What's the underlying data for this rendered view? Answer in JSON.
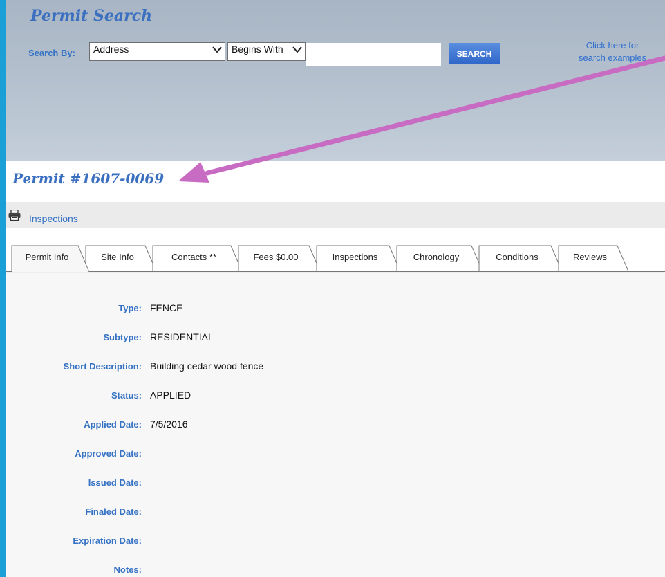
{
  "search": {
    "title": "Permit Search",
    "search_by_label": "Search By:",
    "field_selected": "Address",
    "match_selected": "Begins With",
    "input_value": "",
    "button_label": "SEARCH",
    "examples_link_line1": "Click here for",
    "examples_link_line2": "search examples"
  },
  "permit": {
    "number": "Permit #1607-0069"
  },
  "toolbar": {
    "inspections_label": "Inspections"
  },
  "tabs": [
    {
      "label": "Permit Info",
      "active": true
    },
    {
      "label": "Site Info"
    },
    {
      "label": "Contacts **"
    },
    {
      "label": "Fees $0.00"
    },
    {
      "label": "Inspections"
    },
    {
      "label": "Chronology"
    },
    {
      "label": "Conditions"
    },
    {
      "label": "Reviews"
    }
  ],
  "details": [
    {
      "label": "Type:",
      "value": "FENCE"
    },
    {
      "label": "Subtype:",
      "value": "RESIDENTIAL"
    },
    {
      "label": "Short Description:",
      "value": "Building cedar wood fence"
    },
    {
      "label": "Status:",
      "value": "APPLIED"
    },
    {
      "label": "Applied Date:",
      "value": "7/5/2016"
    },
    {
      "label": "Approved Date:",
      "value": ""
    },
    {
      "label": "Issued Date:",
      "value": ""
    },
    {
      "label": "Finaled Date:",
      "value": ""
    },
    {
      "label": "Expiration Date:",
      "value": ""
    },
    {
      "label": "Notes:",
      "value": ""
    }
  ],
  "colors": {
    "accent_blue": "#3b6fc0",
    "label_blue": "#3572c4",
    "button_blue": "#2f66c9",
    "annotation_arrow": "#c86bc2",
    "page_border": "#1aa0d6"
  },
  "icons": {
    "print": "printer-icon",
    "dropdown": "chevron-down-icon"
  }
}
